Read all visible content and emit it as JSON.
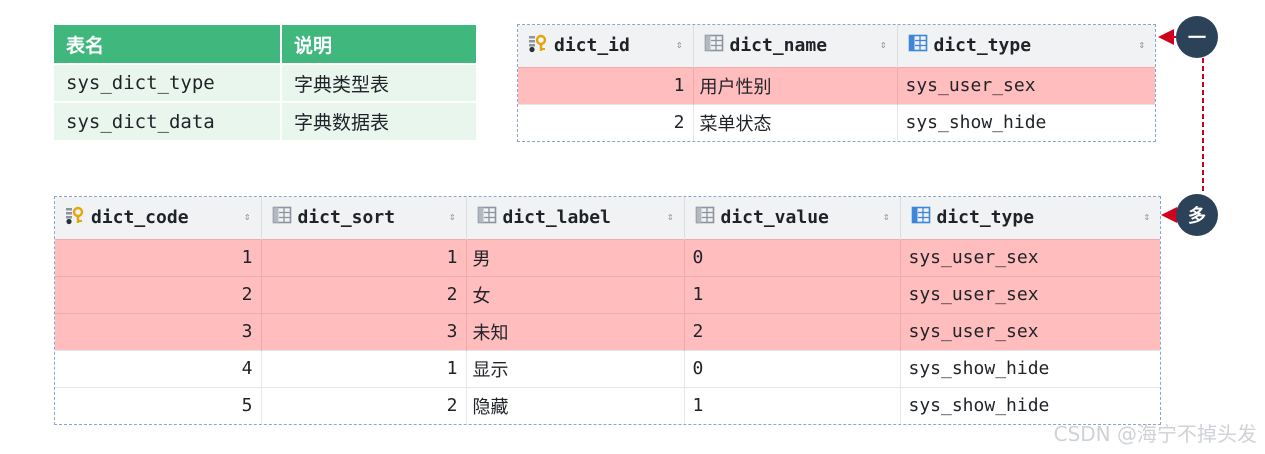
{
  "legend": {
    "headers": [
      "表名",
      "说明"
    ],
    "rows": [
      [
        "sys_dict_type",
        "字典类型表"
      ],
      [
        "sys_dict_data",
        "字典数据表"
      ]
    ]
  },
  "table_top": {
    "columns": [
      "dict_id",
      "dict_name",
      "dict_type"
    ],
    "rows": [
      [
        "1",
        "用户性别",
        "sys_user_sex"
      ],
      [
        "2",
        "菜单状态",
        "sys_show_hide"
      ]
    ]
  },
  "table_bottom": {
    "columns": [
      "dict_code",
      "dict_sort",
      "dict_label",
      "dict_value",
      "dict_type"
    ],
    "rows": [
      [
        "1",
        "1",
        "男",
        "0",
        "sys_user_sex"
      ],
      [
        "2",
        "2",
        "女",
        "1",
        "sys_user_sex"
      ],
      [
        "3",
        "3",
        "未知",
        "2",
        "sys_user_sex"
      ],
      [
        "4",
        "1",
        "显示",
        "0",
        "sys_show_hide"
      ],
      [
        "5",
        "2",
        "隐藏",
        "1",
        "sys_show_hide"
      ]
    ]
  },
  "markers": {
    "one": "一",
    "many": "多"
  },
  "watermark": "CSDN @海宁不掉头发",
  "colors": {
    "header_green": "#3fb77d",
    "row_highlight": "#ffbdbd",
    "marker_bg": "#2c4259",
    "connector_red": "#d0021b"
  },
  "icons": {
    "key_column": "key-column-icon",
    "column": "column-icon",
    "sort": "sort-arrows-icon"
  }
}
